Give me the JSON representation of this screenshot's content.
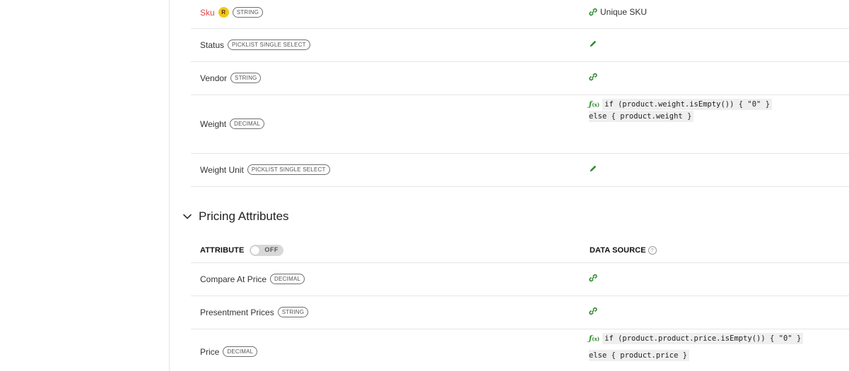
{
  "colors": {
    "accent_green": "#2e8b2e",
    "required_red": "#e0474c",
    "required_badge": "#f5c518"
  },
  "rows_top": [
    {
      "name": "Sku",
      "required": true,
      "required_badge": "R",
      "type": "STRING",
      "source_icon": "link-icon",
      "source_text": "Unique SKU"
    },
    {
      "name": "Status",
      "required": false,
      "type": "PICKLIST SINGLE SELECT",
      "source_icon": "pencil-icon",
      "source_text": ""
    },
    {
      "name": "Vendor",
      "required": false,
      "type": "STRING",
      "source_icon": "link-icon",
      "source_text": ""
    },
    {
      "name": "Weight",
      "required": false,
      "type": "DECIMAL",
      "source_icon": "formula-icon",
      "formula": {
        "fx": "ƒ",
        "fx_sub": "(x)",
        "line1": "if (product.weight.isEmpty()) { \"0\" }",
        "line2": "else { product.weight }"
      }
    },
    {
      "name": "Weight Unit",
      "required": false,
      "type": "PICKLIST SINGLE SELECT",
      "source_icon": "pencil-icon",
      "source_text": ""
    }
  ],
  "section": {
    "title": "Pricing Attributes",
    "expanded": true
  },
  "table_header": {
    "attribute": "ATTRIBUTE",
    "toggle_label": "OFF",
    "data_source": "DATA SOURCE",
    "help": "?"
  },
  "rows_pricing": [
    {
      "name": "Compare At Price",
      "type": "DECIMAL",
      "source_icon": "link-icon"
    },
    {
      "name": "Presentment Prices",
      "type": "STRING",
      "source_icon": "link-icon"
    },
    {
      "name": "Price",
      "type": "DECIMAL",
      "source_icon": "formula-icon",
      "formula": {
        "fx": "ƒ",
        "fx_sub": "(x)",
        "line1": "if (product.product.price.isEmpty()) { \"0\" }",
        "line2": "else { product.price }"
      }
    }
  ]
}
